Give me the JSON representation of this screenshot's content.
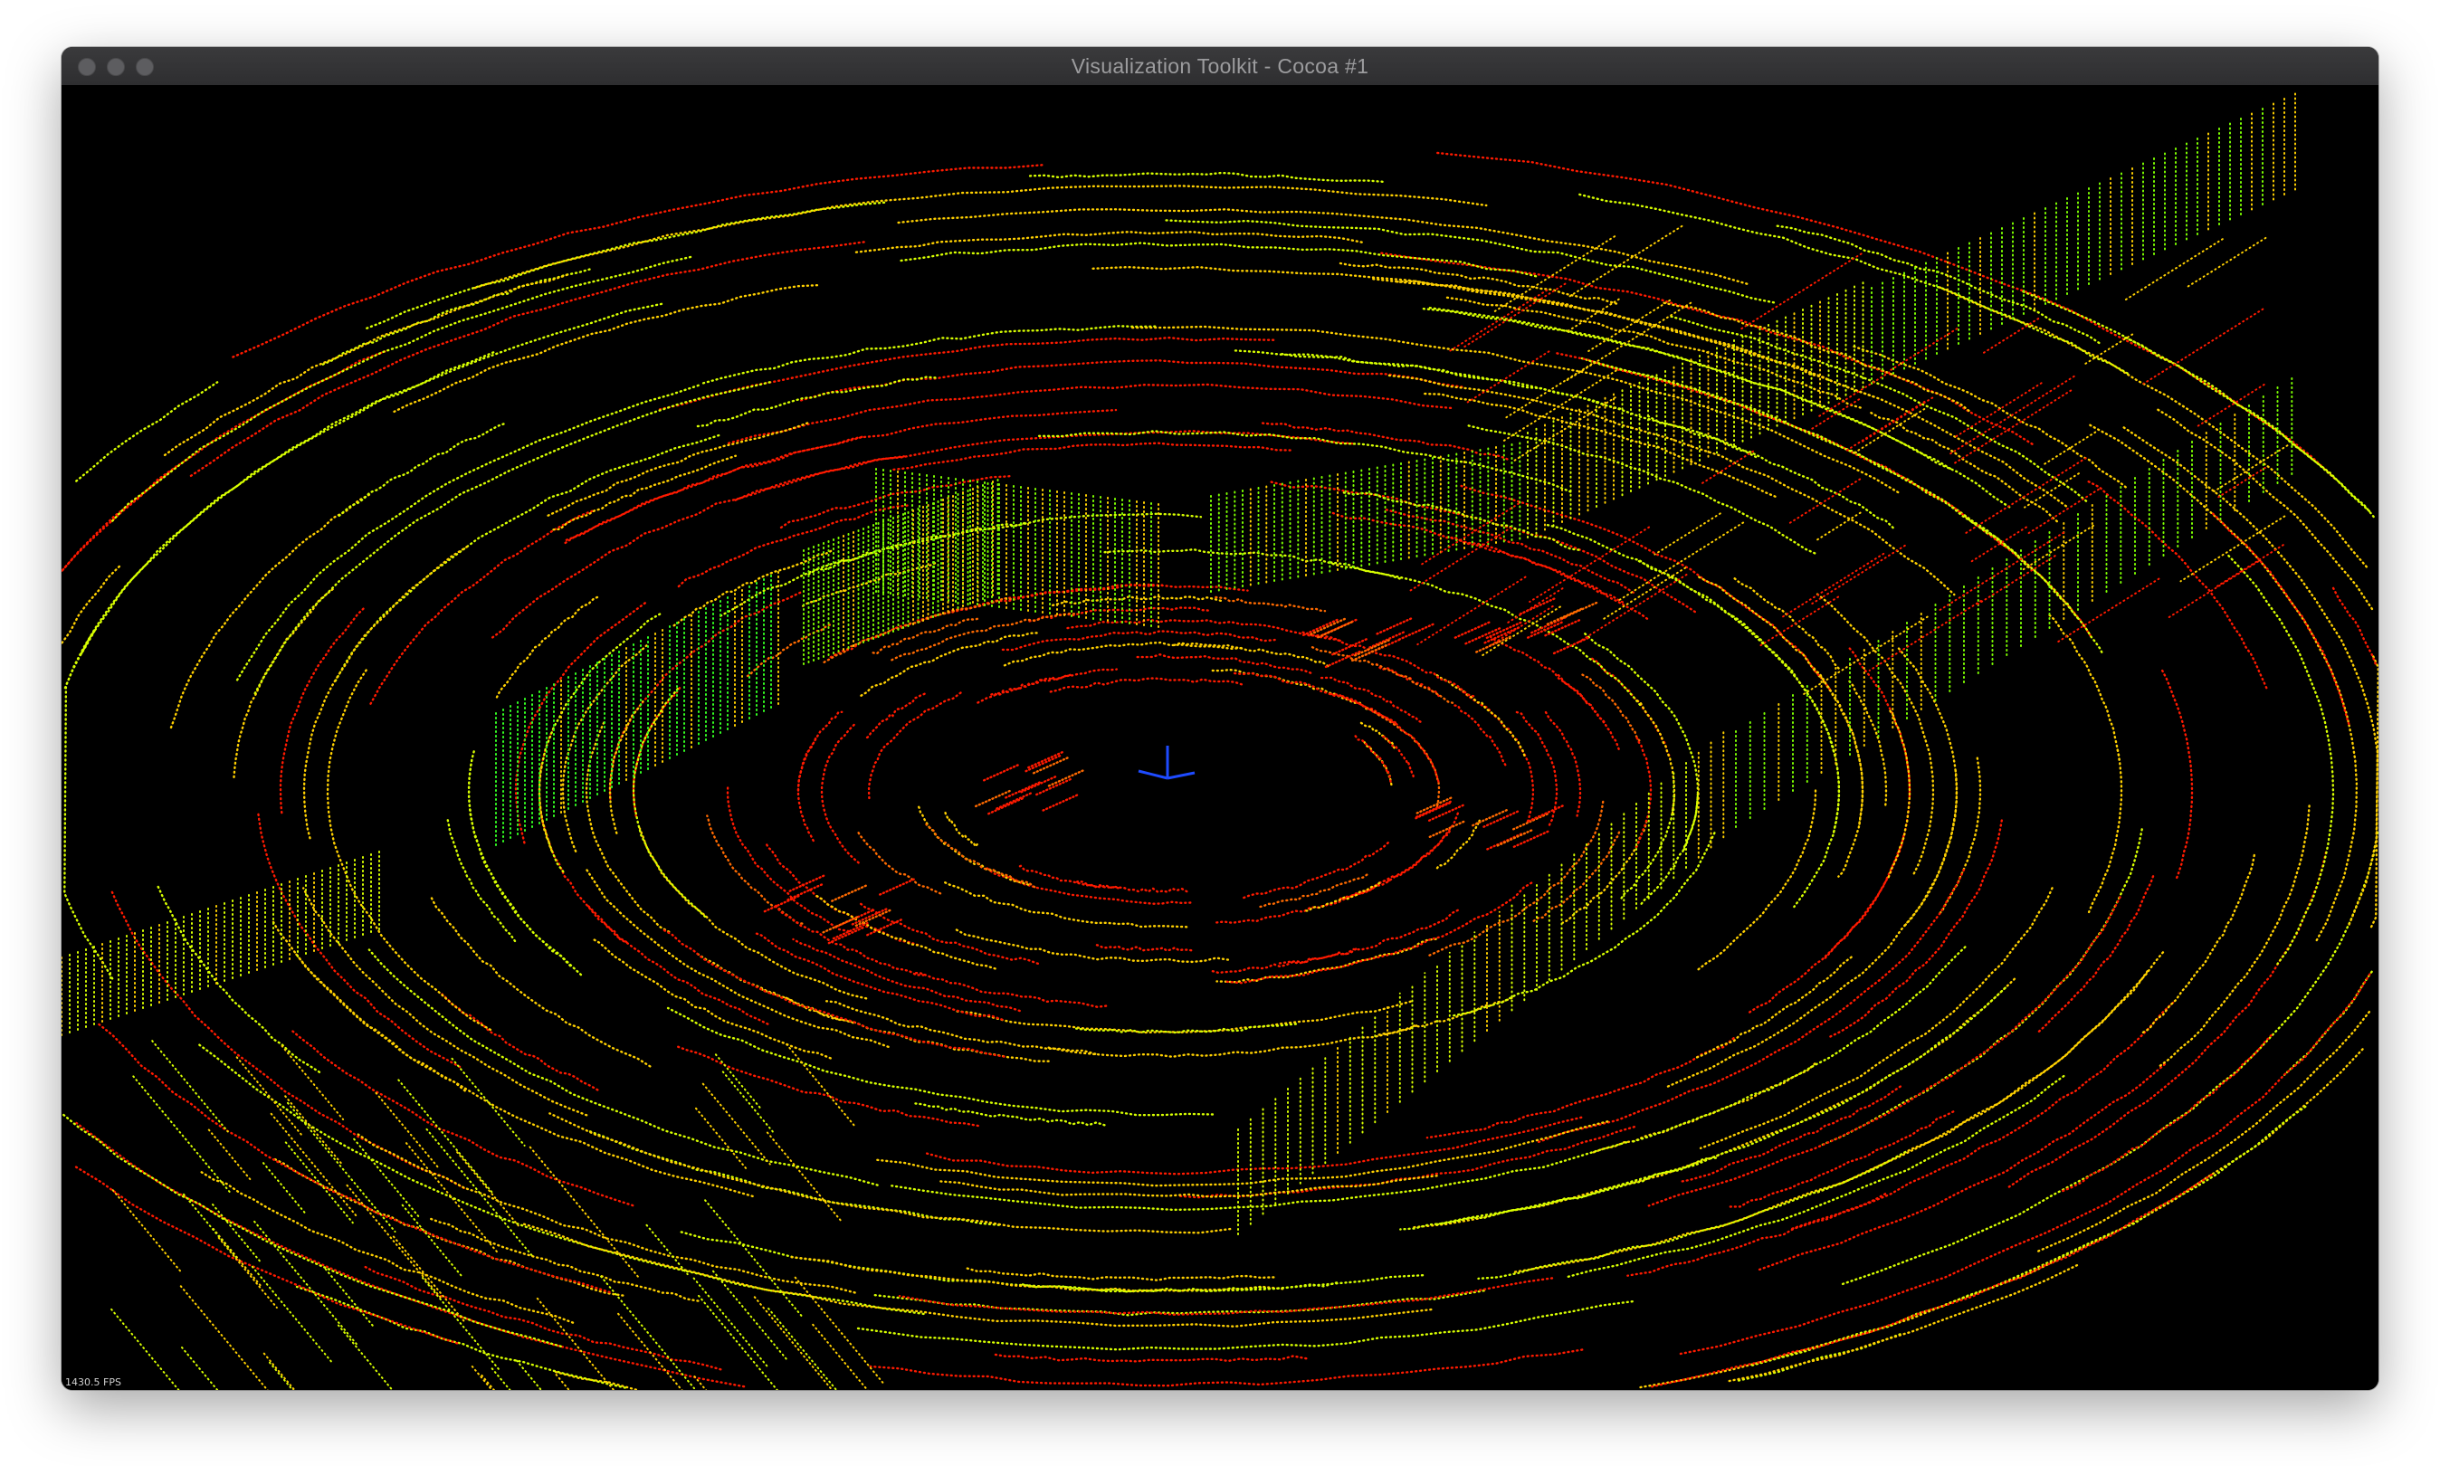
{
  "window": {
    "title": "Visualization Toolkit - Cocoa #1"
  },
  "render": {
    "fps_label": "1430.5 FPS",
    "background": "#000000",
    "point_colors": [
      "#ff1a00",
      "#ff6a00",
      "#ffd000",
      "#d8ff00",
      "#7dff00",
      "#33ff22",
      "#00b4ff",
      "#ff00ff"
    ]
  },
  "icons": {
    "close": "traffic-light-close",
    "minimize": "traffic-light-minimize",
    "maximize": "traffic-light-maximize",
    "axes": "orientation-axes"
  }
}
